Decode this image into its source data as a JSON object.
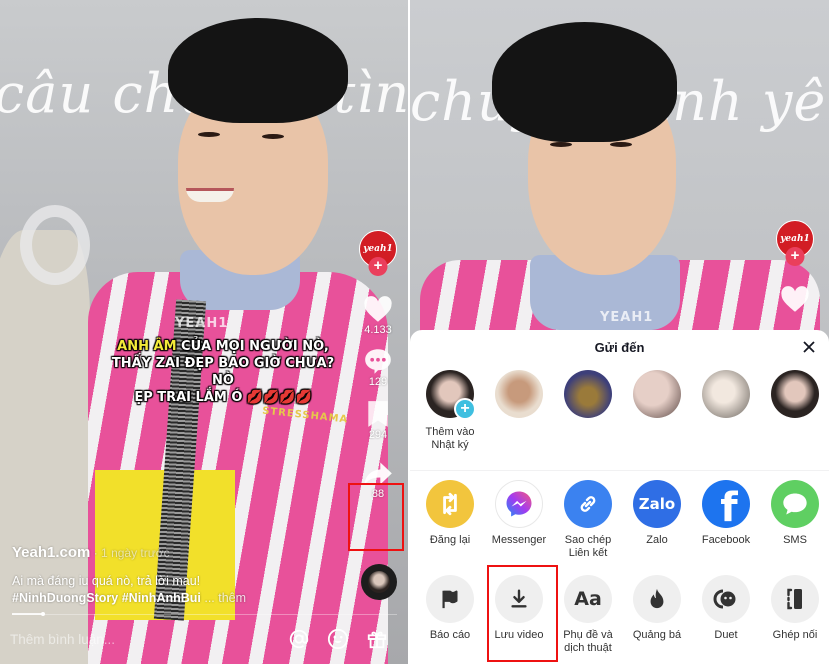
{
  "left_screen": {
    "background_text": "câu chuyện tình",
    "video_caption": {
      "highlight": "ANH ÂM",
      "line1_rest": " CỦA MỌI NGƯỜI NÒ,",
      "line2": "THẤY ZAI ĐẸP BAO GIỜ CHƯA?",
      "line3": "NÒ",
      "line4": "ẸP TRAI LẮM Ó 💋💋💋💋"
    },
    "watermark": "YEAH1",
    "shirt_text": "STRESSHAMA",
    "creator_logo": "yeah1",
    "follow_symbol": "+",
    "likes": "4.133",
    "comments": "129",
    "saves": "294",
    "shares": "88",
    "author": "Yeah1.com",
    "posted": " · 1 ngày trước",
    "description": "Ai mà đáng iu quá nò, trả lời mau!",
    "hashtags": "#NinhDuongStory #NinhAnhBui",
    "more_label": " ... thêm",
    "progress_fraction": 0.08,
    "comment_placeholder": "Thêm bình luận...",
    "highlight_color": "#ee1111"
  },
  "right_screen": {
    "background_text": "chuyện tình yêu",
    "watermark": "YEAH1",
    "creator_logo": "yeah1",
    "follow_symbol": "+",
    "share_sheet": {
      "title": "Gửi đến",
      "close_icon": "close-icon",
      "contacts": [
        {
          "label": "Thêm vào\nNhật ký",
          "line1": "Thêm vào",
          "line2": "Nhật ký",
          "has_add": true,
          "color": "#2b2422"
        },
        {
          "label": "",
          "color": "#c9a68c"
        },
        {
          "label": "",
          "color": "#3d3f7a"
        },
        {
          "label": "",
          "color": "#d8b8ae"
        },
        {
          "label": "",
          "color": "#b9b2ab"
        },
        {
          "label": "",
          "color": "#2b2422"
        }
      ],
      "share_row": [
        {
          "icon": "repost-icon",
          "line1": "Đăng lại",
          "line2": "",
          "color": "#f2c53d"
        },
        {
          "icon": "messenger-icon",
          "line1": "Messenger",
          "line2": "",
          "color": "#ffffff"
        },
        {
          "icon": "link-icon",
          "line1": "Sao chép",
          "line2": "Liên kết",
          "color": "#3b82f0"
        },
        {
          "icon": "zalo-icon",
          "line1": "Zalo",
          "line2": "",
          "color": "#2f6ee5",
          "glyph": "Zalo"
        },
        {
          "icon": "facebook-icon",
          "line1": "Facebook",
          "line2": "",
          "color": "#1d74ef",
          "glyph": "f"
        },
        {
          "icon": "sms-icon",
          "line1": "SMS",
          "line2": "",
          "color": "#5fcf62"
        }
      ],
      "action_row": [
        {
          "icon": "flag-icon",
          "line1": "Báo cáo",
          "line2": ""
        },
        {
          "icon": "download-icon",
          "line1": "Lưu video",
          "line2": ""
        },
        {
          "icon": "captions-icon",
          "line1": "Phụ đề và",
          "line2": "dịch thuật",
          "glyph": "Aa"
        },
        {
          "icon": "flame-icon",
          "line1": "Quảng bá",
          "line2": ""
        },
        {
          "icon": "duet-icon",
          "line1": "Duet",
          "line2": ""
        },
        {
          "icon": "stitch-icon",
          "line1": "Ghép nối",
          "line2": ""
        }
      ]
    }
  }
}
